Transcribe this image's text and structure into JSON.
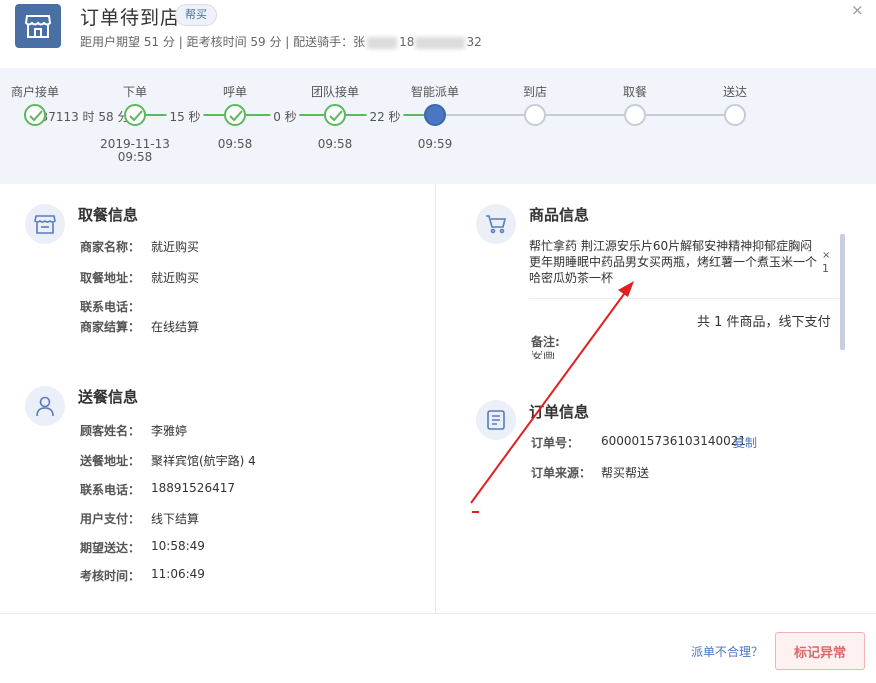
{
  "header": {
    "title": "订单待到店",
    "badge": "帮买",
    "subtitle": "距用户期望 51 分 | 距考核时间 59 分 | 配送骑手：张",
    "rider_phone_partial": "18",
    "rider_phone_tail": "32",
    "close_label": "×"
  },
  "progress": {
    "steps": [
      {
        "label": "商户接单",
        "status": "done",
        "time": ""
      },
      {
        "label": "下单",
        "status": "done",
        "time": "2019-11-13\n09:58"
      },
      {
        "label": "呼单",
        "status": "done",
        "time": "09:58"
      },
      {
        "label": "团队接单",
        "status": "done",
        "time": "09:58"
      },
      {
        "label": "智能派单",
        "status": "active",
        "time": "09:59"
      },
      {
        "label": "到店",
        "status": "todo",
        "time": ""
      },
      {
        "label": "取餐",
        "status": "todo",
        "time": ""
      },
      {
        "label": "送达",
        "status": "todo",
        "time": ""
      }
    ],
    "durations": [
      "37113 时 58 分",
      "15 秒",
      "0 秒",
      "22 秒"
    ],
    "colors": {
      "done": "#5cb85c",
      "active": "#4a76c2",
      "todo": "#c6ccd6"
    }
  },
  "pickup": {
    "title": "取餐信息",
    "fields": [
      {
        "key": "商家名称：",
        "value": "就近购买"
      },
      {
        "key": "取餐地址：",
        "value": "就近购买"
      },
      {
        "key": "联系电话：",
        "value": ""
      },
      {
        "key": "商家结算：",
        "value": "在线结算"
      }
    ]
  },
  "delivery": {
    "title": "送餐信息",
    "fields": [
      {
        "key": "顾客姓名：",
        "value": "李雅婷"
      },
      {
        "key": "送餐地址：",
        "value": "聚祥宾馆(航宇路) 4"
      },
      {
        "key": "联系电话：",
        "value": "18891526417"
      },
      {
        "key": "用户支付：",
        "value": "线下结算"
      },
      {
        "key": "期望送达：",
        "value": "10:58:49"
      },
      {
        "key": "考核时间：",
        "value": "11:06:49"
      }
    ]
  },
  "goods": {
    "title": "商品信息",
    "description": "帮忙拿药 荆江源安乐片60片解郁安神精神抑郁症胸闷更年期睡眠中药品男女买两瓶，烤红薯一个煮玉米一个哈密瓜奶茶一杯",
    "x_mark": "×",
    "qty": "1",
    "total": "共 1 件商品，线下支付",
    "remark_label": "备注:",
    "remark_partial": "安画"
  },
  "order": {
    "title": "订单信息",
    "fields": [
      {
        "key": "订单号：",
        "value": "6000015736103140021"
      },
      {
        "key": "订单来源：",
        "value": "帮买帮送"
      }
    ],
    "copy_label": "复制"
  },
  "footer": {
    "dispatch_link": "派单不合理？",
    "mark_button": "标记异常"
  },
  "icons": {
    "header": "shop-icon",
    "pickup": "shop-icon",
    "delivery": "user-icon",
    "goods": "cart-icon",
    "order": "document-icon",
    "done": "check-icon"
  }
}
